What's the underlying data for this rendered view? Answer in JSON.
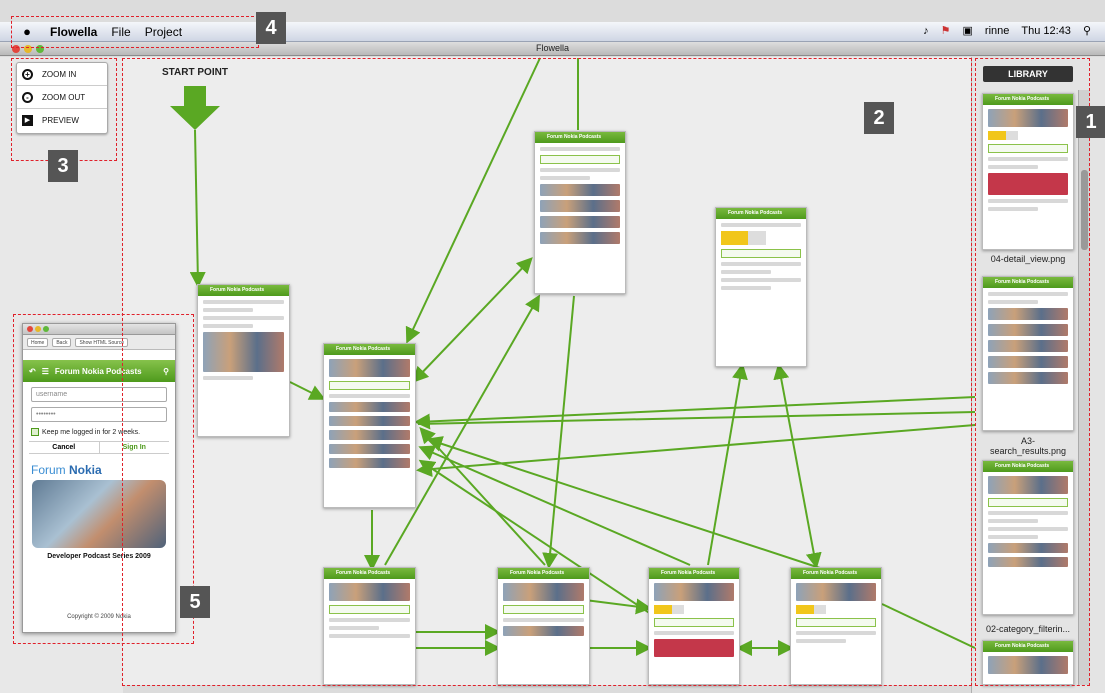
{
  "menubar": {
    "app_name": "Flowella",
    "menus": [
      "File",
      "Project"
    ],
    "user": "rinne",
    "clock": "Thu 12:43"
  },
  "window": {
    "title": "Flowella"
  },
  "zoom_panel": {
    "zoom_in": "ZOOM IN",
    "zoom_out": "ZOOM OUT",
    "preview": "PREVIEW"
  },
  "canvas": {
    "start_label": "START POINT"
  },
  "library": {
    "button": "LIBRARY",
    "items": [
      "04-detail_view.png",
      "A3-search_results.png",
      "02-category_filterin..."
    ]
  },
  "preview": {
    "toolbar": [
      "Home",
      "Back",
      "Show HTML Source"
    ],
    "header_title": "Forum Nokia Podcasts",
    "username_placeholder": "username",
    "password_placeholder": "••••••••",
    "keep_logged": "Keep me logged in for 2 weeks.",
    "cancel": "Cancel",
    "sign_in": "Sign In",
    "logo_prefix": "Forum ",
    "logo_brand": "Nokia",
    "caption": "Developer Podcast Series 2009",
    "copyright": "Copyright © 2009 Nokia"
  },
  "screen_header": "Forum Nokia Podcasts",
  "annotations": {
    "n1": "1",
    "n2": "2",
    "n3": "3",
    "n4": "4",
    "n5": "5"
  },
  "colors": {
    "accent_green": "#5aa823",
    "annotation_red": "#e0202a",
    "badge_gray": "#555555"
  }
}
